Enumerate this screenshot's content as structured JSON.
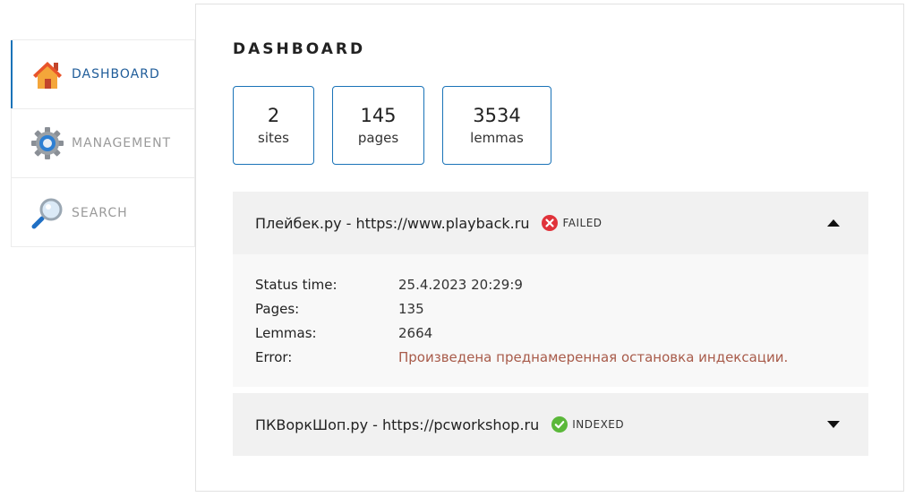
{
  "sidebar": {
    "items": [
      {
        "label": "DASHBOARD",
        "icon": "home-icon",
        "active": true
      },
      {
        "label": "MANAGEMENT",
        "icon": "gear-icon",
        "active": false
      },
      {
        "label": "SEARCH",
        "icon": "magnifier-icon",
        "active": false
      }
    ]
  },
  "main": {
    "title": "DASHBOARD",
    "stats": [
      {
        "value": "2",
        "label": "sites"
      },
      {
        "value": "145",
        "label": "pages"
      },
      {
        "value": "3534",
        "label": "lemmas"
      }
    ],
    "sites": [
      {
        "name": "Плейбек.ру - https://www.playback.ru",
        "status": "FAILED",
        "status_icon": "error-icon",
        "expanded": true,
        "details": {
          "status_time_label": "Status time:",
          "status_time": "25.4.2023 20:29:9",
          "pages_label": "Pages:",
          "pages": "135",
          "lemmas_label": "Lemmas:",
          "lemmas": "2664",
          "error_label": "Error:",
          "error": "Произведена преднамеренная остановка индексации."
        }
      },
      {
        "name": "ПКВоркШоп.ру - https://pcworkshop.ru",
        "status": "INDEXED",
        "status_icon": "check-icon",
        "expanded": false
      }
    ]
  },
  "colors": {
    "accent": "#1a73b8",
    "failed": "#e0323a",
    "indexed": "#5bb83a",
    "error_text": "#a85b4a"
  }
}
